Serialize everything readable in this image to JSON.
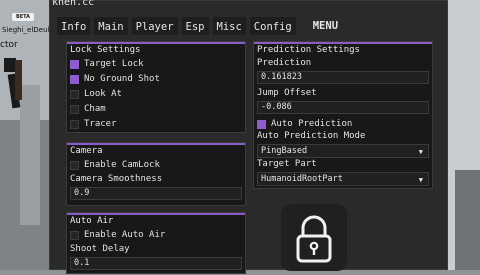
{
  "window": {
    "title": "khen.cc",
    "tabs": [
      "Info",
      "Main",
      "Player",
      "Esp",
      "Misc",
      "Config"
    ],
    "active_section": "MENU"
  },
  "game": {
    "badge": "BETA",
    "player_tag": "Sieghi_elDeul",
    "player_name_partial": "ctor"
  },
  "lock_settings": {
    "title": "Lock Settings",
    "options": [
      {
        "label": "Target Lock",
        "checked": true
      },
      {
        "label": "No Ground Shot",
        "checked": true
      },
      {
        "label": "Look At",
        "checked": false
      },
      {
        "label": "Cham",
        "checked": false
      },
      {
        "label": "Tracer",
        "checked": false
      }
    ]
  },
  "camera": {
    "title": "Camera",
    "enable_label": "Enable CamLock",
    "enable_checked": false,
    "smoothness_label": "Camera Smoothness",
    "smoothness_value": "0.9"
  },
  "auto_air": {
    "title": "Auto Air",
    "enable_label": "Enable Auto Air",
    "enable_checked": false,
    "delay_label": "Shoot Delay",
    "delay_value": "0.1"
  },
  "prediction": {
    "title": "Prediction Settings",
    "prediction_label": "Prediction",
    "prediction_value": "0.161823",
    "jump_label": "Jump Offset",
    "jump_value": "-0.086",
    "auto_label": "Auto Prediction",
    "auto_checked": true,
    "mode_label": "Auto Prediction Mode",
    "mode_value": "PingBased",
    "target_label": "Target Part",
    "target_value": "HumanoidRootPart"
  },
  "colors": {
    "accent": "#8e5ccd",
    "window_bg": "#2a2a2a",
    "panel_bg": "#181818"
  }
}
